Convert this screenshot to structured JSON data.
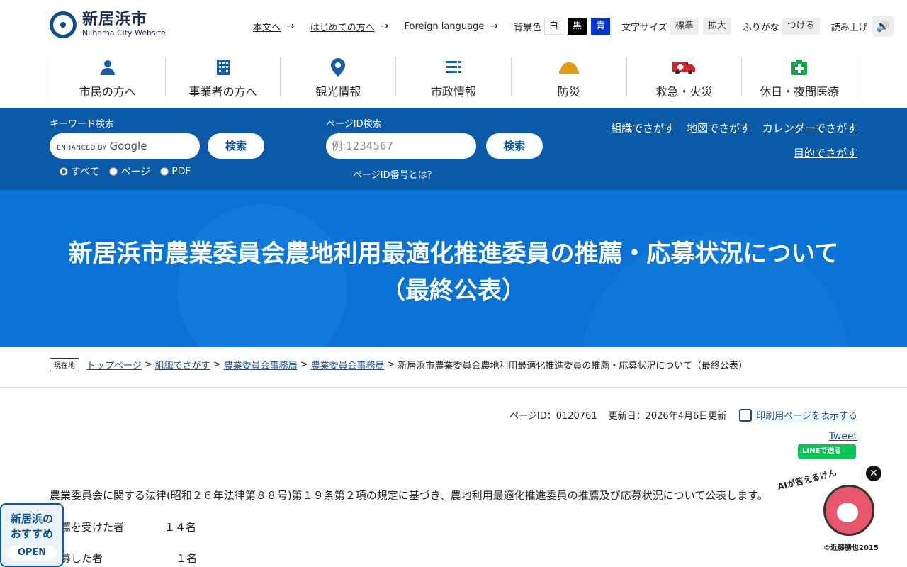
{
  "header": {
    "logo_title": "新居浜市",
    "logo_sub": "Niihama City Website",
    "links": [
      {
        "label": "本文へ"
      },
      {
        "label": "はじめての方へ"
      },
      {
        "label": "Foreign language"
      }
    ],
    "arrow": "→",
    "bg_label": "背景色",
    "bg_options": [
      "白",
      "黒",
      "青"
    ],
    "font_label": "文字サイズ",
    "font_options": [
      "標準",
      "拡大"
    ],
    "furigana_label": "ふりがな",
    "furigana_btn": "つける",
    "read_label": "読み上げ",
    "speaker_icon": "🔊"
  },
  "gnav": [
    {
      "label": "市民の方へ",
      "icon": "person-icon"
    },
    {
      "label": "事業者の方へ",
      "icon": "building-icon"
    },
    {
      "label": "観光情報",
      "icon": "map-pin-icon"
    },
    {
      "label": "市政情報",
      "icon": "list-icon"
    },
    {
      "label": "防災",
      "icon": "helmet-icon"
    },
    {
      "label": "救急・火災",
      "icon": "ambulance-icon"
    },
    {
      "label": "休日・夜間医療",
      "icon": "medical-icon"
    }
  ],
  "search": {
    "keyword_label": "キーワード検索",
    "google_brand": "ENHANCED BY",
    "google_name": "Google",
    "search_btn": "検索",
    "radios": [
      "すべて",
      "ページ",
      "PDF"
    ],
    "pageid_label": "ページID検索",
    "pageid_placeholder": "例:1234567",
    "pageid_btn": "検索",
    "pageid_help": "ページID番号とは？",
    "links_row1": [
      "組織でさがす",
      "地図でさがす",
      "カレンダーでさがす"
    ],
    "links_row2": [
      "目的でさがす"
    ]
  },
  "title": "新居浜市農業委員会農地利用最適化推進委員の推薦・応募状況について（最終公表）",
  "breadcrumb": {
    "here": "現在地",
    "items": [
      "トップページ",
      "組織でさがす",
      "農業委員会事務局",
      "農業委員会事務局"
    ],
    "sep": ">",
    "current": "新居浜市農業委員会農地利用最適化推進委員の推薦・応募状況について（最終公表）"
  },
  "meta": {
    "page_id": "ページID：0120761",
    "updated": "更新日：2026年4月6日更新",
    "print": "印刷用ページを表示する",
    "tweet": "Tweet",
    "line": "LINEで送る"
  },
  "body": {
    "intro": "農業委員会に関する法律(昭和２６年法律第８８号)第１９条第２項の規定に基づき、農地利用最適化推進委員の推薦及び応募状況について公表します。",
    "row1_label": "推薦を受けた者",
    "row1_value": "１４名",
    "row2_label": "応募した者",
    "row2_value": "１名"
  },
  "widgets": {
    "osusume_line1": "新居浜の",
    "osusume_line2": "おすすめ",
    "osusume_open": "OPEN",
    "ai_label": "AIが答えるけん",
    "ai_copy": "©近藤勝也2015",
    "close_icon": "✕"
  }
}
